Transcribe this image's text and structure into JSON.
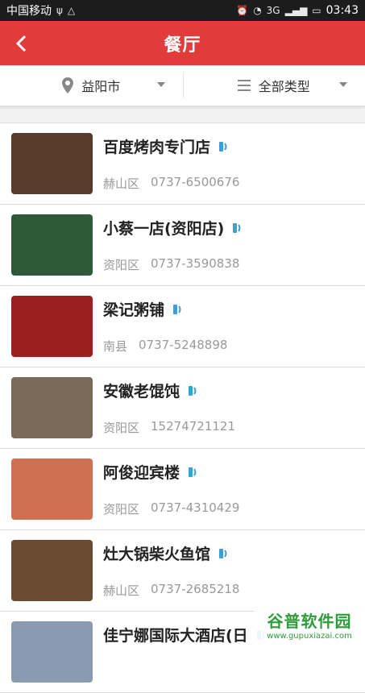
{
  "status_bar": {
    "carrier": "中国移动",
    "network": "3G",
    "time": "03:43"
  },
  "header": {
    "title": "餐厅",
    "background": "#e23b3b"
  },
  "filters": {
    "city": "益阳市",
    "type": "全部类型"
  },
  "restaurants": [
    {
      "name": "百度烤肉专门店",
      "district": "赫山区",
      "phone": "0737-6500676",
      "thumb_color": "#5a3a2a"
    },
    {
      "name": "小蔡一店(资阳店)",
      "district": "资阳区",
      "phone": "0737-3590838",
      "thumb_color": "#2f5a3a"
    },
    {
      "name": "梁记粥铺",
      "district": "南县",
      "phone": "0737-5248898",
      "thumb_color": "#9a2020"
    },
    {
      "name": "安徽老馄饨",
      "district": "资阳区",
      "phone": "15274721121",
      "thumb_color": "#7a6a5a"
    },
    {
      "name": "阿俊迎宾楼",
      "district": "资阳区",
      "phone": "0737-4310429",
      "thumb_color": "#d07050"
    },
    {
      "name": "灶大锅柴火鱼馆",
      "district": "赫山区",
      "phone": "0737-2685218",
      "thumb_color": "#6a4a30"
    },
    {
      "name": "佳宁娜国际大酒店(日",
      "district": "",
      "phone": "",
      "thumb_color": "#8a9ab0"
    }
  ],
  "watermark": {
    "title": "谷普软件园",
    "url": "www.gupuxiazai.com"
  }
}
